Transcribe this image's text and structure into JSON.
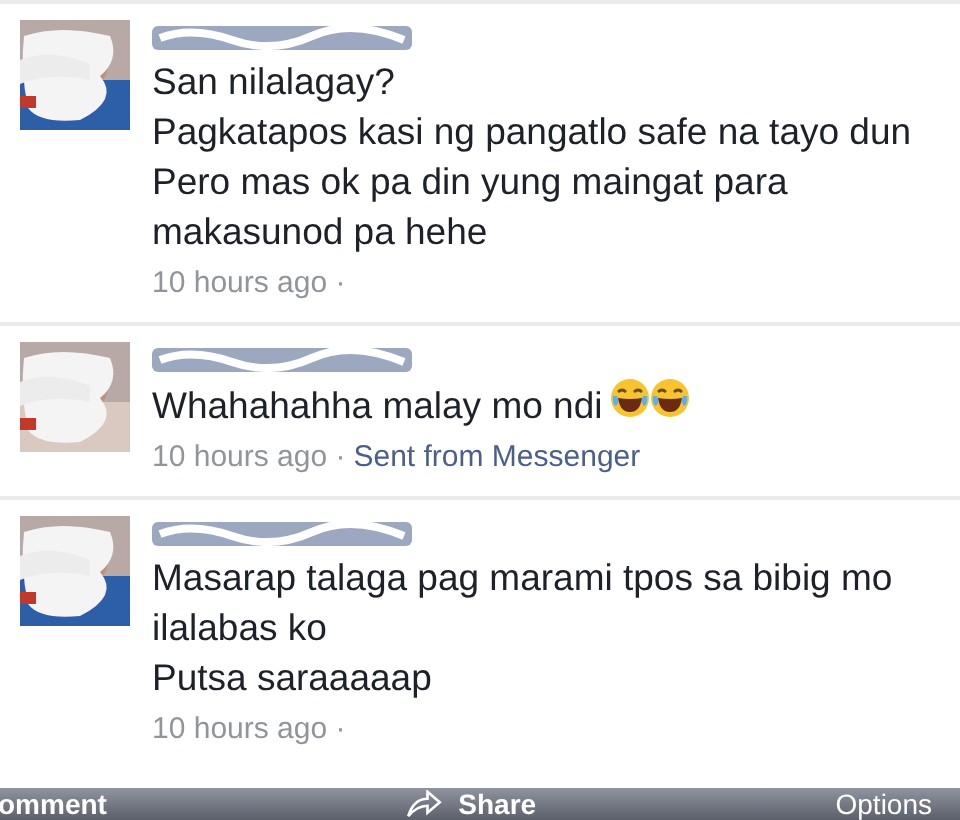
{
  "comments": [
    {
      "lines": [
        "San nilalagay?",
        "Pagkatapos kasi ng pangatlo safe na tayo dun",
        "Pero mas ok pa din yung maingat para",
        "makasunod pa hehe"
      ],
      "time": "10 hours ago ·"
    },
    {
      "lines": [
        "Whahahahha malay mo ndi"
      ],
      "emojis": [
        {
          "kind": "laughing"
        },
        {
          "kind": "laughing"
        }
      ],
      "time": "10 hours ago ·",
      "via": "Sent from Messenger"
    },
    {
      "lines": [
        "Masarap talaga pag marami tpos sa bibig mo",
        "ilalabas ko",
        "Putsa saraaaaap"
      ],
      "time": "10 hours ago ·"
    }
  ],
  "action_bar": [
    {
      "label": "omment",
      "kind": "text"
    },
    {
      "label": "Share",
      "kind": "share"
    },
    {
      "label": "Options",
      "kind": "text"
    }
  ]
}
